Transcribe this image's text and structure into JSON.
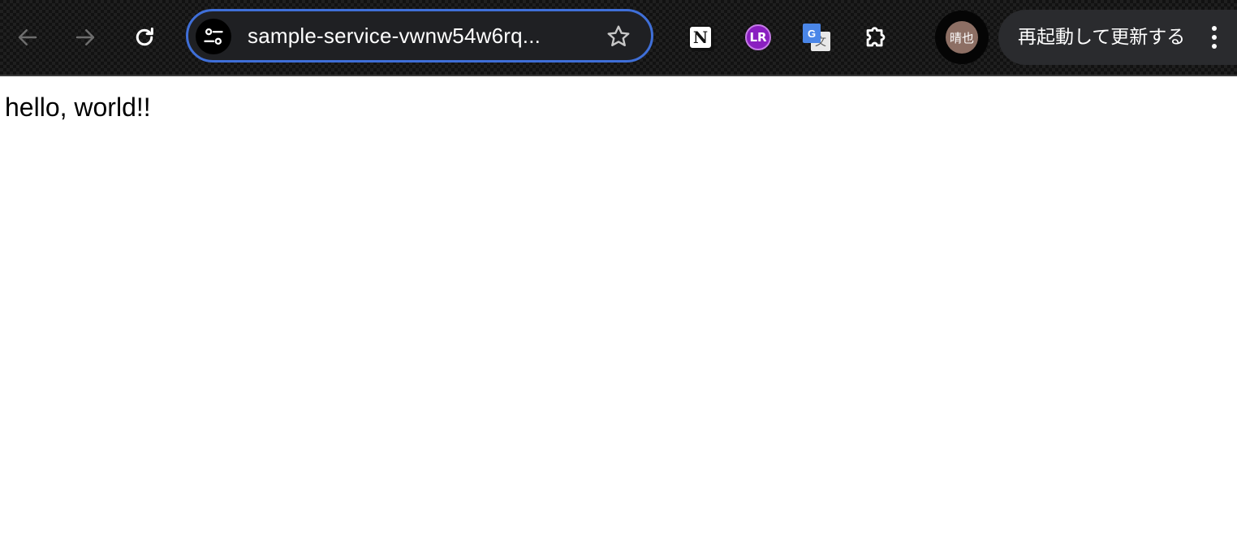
{
  "browser": {
    "nav": {
      "back_icon": "arrow-left-icon",
      "forward_icon": "arrow-right-icon",
      "reload_icon": "reload-icon"
    },
    "omnibox": {
      "url": "sample-service-vwnw54w6rq...",
      "site_info_icon": "tune-icon",
      "bookmark_icon": "star-outline-icon",
      "focus_ring_color": "#3f6fd8"
    },
    "extensions": [
      {
        "name": "Notion",
        "icon": "notion-icon",
        "glyph": "N"
      },
      {
        "name": "LR",
        "icon": "language-reactor-icon",
        "glyph": "LR",
        "color": "#8a1fc0"
      },
      {
        "name": "Google Translate",
        "icon": "google-translate-icon",
        "glyph_front": "G",
        "glyph_back": "文",
        "color": "#4a86e8"
      },
      {
        "name": "Extensions",
        "icon": "puzzle-icon"
      }
    ],
    "profile": {
      "avatar_text": "晴也",
      "avatar_color": "#8d6f64"
    },
    "restart": {
      "label": "再起動して更新する"
    },
    "menu_icon": "more-vert-icon"
  },
  "page": {
    "text": "hello, world!!"
  }
}
